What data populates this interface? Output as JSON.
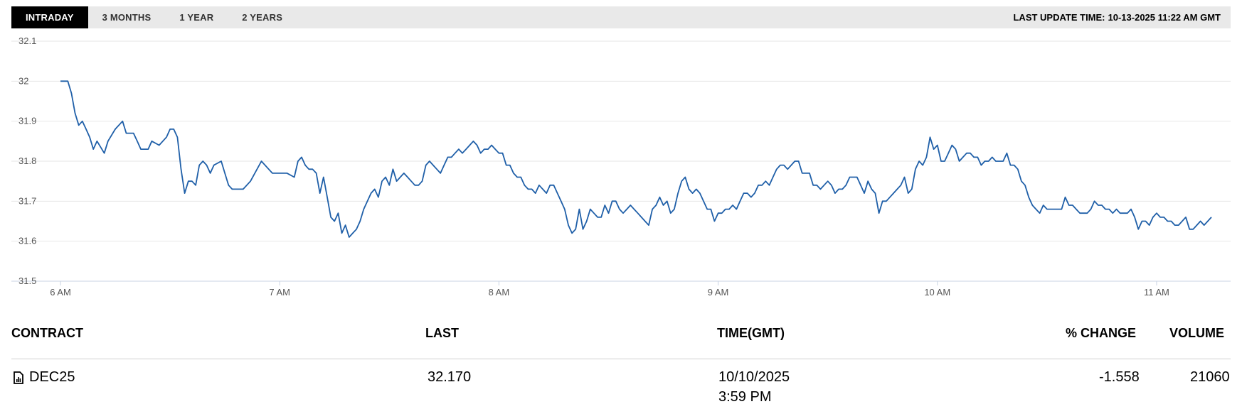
{
  "tabs": [
    {
      "label": "INTRADAY",
      "active": true
    },
    {
      "label": "3 MONTHS",
      "active": false
    },
    {
      "label": "1 YEAR",
      "active": false
    },
    {
      "label": "2 YEARS",
      "active": false
    }
  ],
  "last_update": {
    "label": "LAST UPDATE TIME:",
    "value": "10-13-2025 11:22 AM GMT"
  },
  "chart_data": {
    "type": "line",
    "title": "",
    "xlabel": "",
    "ylabel": "",
    "y_ticks": [
      "32.1",
      "32",
      "31.9",
      "31.8",
      "31.7",
      "31.6",
      "31.5"
    ],
    "ylim": [
      31.5,
      32.1
    ],
    "x_ticks": [
      "6 AM",
      "7 AM",
      "8 AM",
      "9 AM",
      "10 AM",
      "11 AM"
    ],
    "x_tick_minutes": [
      360,
      420,
      480,
      540,
      600,
      660
    ],
    "xlim_minutes": [
      360,
      675
    ],
    "grid": true,
    "line_color": "#1f5fa8",
    "series": [
      {
        "x_minutes": [
          360,
          362,
          363,
          364,
          365,
          366,
          367,
          368,
          369,
          370,
          372,
          373,
          375,
          377,
          378,
          380,
          381,
          382,
          384,
          385,
          387,
          389,
          390,
          391,
          392,
          393,
          394,
          395,
          396,
          397,
          398,
          399,
          400,
          401,
          402,
          404,
          405,
          406,
          407,
          408,
          409,
          410,
          412,
          415,
          418,
          420,
          422,
          424,
          425,
          426,
          427,
          428,
          429,
          430,
          431,
          432,
          433,
          434,
          435,
          436,
          437,
          438,
          439,
          440,
          441,
          442,
          443,
          444,
          445,
          446,
          447,
          448,
          449,
          450,
          451,
          452,
          453,
          454,
          455,
          456,
          457,
          458,
          459,
          460,
          461,
          462,
          463,
          464,
          465,
          466,
          467,
          468,
          469,
          470,
          471,
          472,
          473,
          474,
          475,
          476,
          477,
          478,
          479,
          480,
          481,
          482,
          483,
          484,
          485,
          486,
          487,
          488,
          489,
          490,
          491,
          492,
          493,
          494,
          495,
          496,
          497,
          498,
          499,
          500,
          501,
          502,
          503,
          504,
          505,
          506,
          507,
          508,
          509,
          510,
          511,
          512,
          513,
          514,
          515,
          516,
          517,
          518,
          519,
          520,
          521,
          522,
          523,
          524,
          525,
          526,
          527,
          528,
          529,
          530,
          531,
          532,
          533,
          534,
          535,
          536,
          537,
          538,
          539,
          540,
          541,
          542,
          543,
          544,
          545,
          546,
          547,
          548,
          549,
          550,
          551,
          552,
          553,
          554,
          555,
          556,
          557,
          558,
          559,
          560,
          561,
          562,
          563,
          564,
          565,
          566,
          567,
          568,
          569,
          570,
          571,
          572,
          573,
          574,
          575,
          576,
          577,
          578,
          579,
          580,
          581,
          582,
          583,
          584,
          585,
          586,
          587,
          588,
          589,
          590,
          591,
          592,
          593,
          594,
          595,
          596,
          597,
          598,
          599,
          600,
          601,
          602,
          603,
          604,
          605,
          606,
          607,
          608,
          609,
          610,
          611,
          612,
          613,
          614,
          615,
          616,
          617,
          618,
          619,
          620,
          621,
          622,
          623,
          624,
          625,
          626,
          627,
          628,
          629,
          630,
          631,
          632,
          633,
          634,
          635,
          636,
          637,
          638,
          639,
          640,
          641,
          642,
          643,
          644,
          645,
          646,
          647,
          648,
          649,
          650,
          651,
          652,
          653,
          654,
          655,
          656,
          657,
          658,
          659,
          660,
          661,
          662,
          663,
          664,
          665,
          666,
          667,
          668,
          669,
          670,
          671,
          672,
          673,
          674,
          675
        ],
        "values": [
          32.0,
          32.0,
          31.97,
          31.92,
          31.89,
          31.9,
          31.88,
          31.86,
          31.83,
          31.85,
          31.82,
          31.85,
          31.88,
          31.9,
          31.87,
          31.87,
          31.85,
          31.83,
          31.83,
          31.85,
          31.84,
          31.86,
          31.88,
          31.88,
          31.86,
          31.78,
          31.72,
          31.75,
          31.75,
          31.74,
          31.79,
          31.8,
          31.79,
          31.77,
          31.79,
          31.8,
          31.77,
          31.74,
          31.73,
          31.73,
          31.73,
          31.73,
          31.75,
          31.8,
          31.77,
          31.77,
          31.77,
          31.76,
          31.8,
          31.81,
          31.79,
          31.78,
          31.78,
          31.77,
          31.72,
          31.76,
          31.71,
          31.66,
          31.65,
          31.67,
          31.62,
          31.64,
          31.61,
          31.62,
          31.63,
          31.65,
          31.68,
          31.7,
          31.72,
          31.73,
          31.71,
          31.75,
          31.76,
          31.74,
          31.78,
          31.75,
          31.76,
          31.77,
          31.76,
          31.75,
          31.74,
          31.74,
          31.75,
          31.79,
          31.8,
          31.79,
          31.78,
          31.77,
          31.79,
          31.81,
          31.81,
          31.82,
          31.83,
          31.82,
          31.83,
          31.84,
          31.85,
          31.84,
          31.82,
          31.83,
          31.83,
          31.84,
          31.83,
          31.82,
          31.82,
          31.79,
          31.79,
          31.77,
          31.76,
          31.76,
          31.74,
          31.73,
          31.73,
          31.72,
          31.74,
          31.73,
          31.72,
          31.74,
          31.74,
          31.72,
          31.7,
          31.68,
          31.64,
          31.62,
          31.63,
          31.68,
          31.63,
          31.65,
          31.68,
          31.67,
          31.66,
          31.66,
          31.69,
          31.67,
          31.7,
          31.7,
          31.68,
          31.67,
          31.68,
          31.69,
          31.68,
          31.67,
          31.66,
          31.65,
          31.64,
          31.68,
          31.69,
          31.71,
          31.69,
          31.7,
          31.67,
          31.68,
          31.72,
          31.75,
          31.76,
          31.73,
          31.72,
          31.73,
          31.72,
          31.7,
          31.68,
          31.68,
          31.65,
          31.67,
          31.67,
          31.68,
          31.68,
          31.69,
          31.68,
          31.7,
          31.72,
          31.72,
          31.71,
          31.72,
          31.74,
          31.74,
          31.75,
          31.74,
          31.76,
          31.78,
          31.79,
          31.79,
          31.78,
          31.79,
          31.8,
          31.8,
          31.77,
          31.77,
          31.77,
          31.74,
          31.74,
          31.73,
          31.74,
          31.75,
          31.74,
          31.72,
          31.73,
          31.73,
          31.74,
          31.76,
          31.76,
          31.76,
          31.74,
          31.72,
          31.75,
          31.73,
          31.72,
          31.67,
          31.7,
          31.7,
          31.71,
          31.72,
          31.73,
          31.74,
          31.76,
          31.72,
          31.73,
          31.78,
          31.8,
          31.79,
          31.81,
          31.86,
          31.83,
          31.84,
          31.8,
          31.8,
          31.82,
          31.84,
          31.83,
          31.8,
          31.81,
          31.82,
          31.82,
          31.81,
          31.81,
          31.79,
          31.8,
          31.8,
          31.81,
          31.8,
          31.8,
          31.8,
          31.82,
          31.79,
          31.79,
          31.78,
          31.75,
          31.74,
          31.71,
          31.69,
          31.68,
          31.67,
          31.69,
          31.68,
          31.68,
          31.68,
          31.68,
          31.68,
          31.71,
          31.69,
          31.69,
          31.68,
          31.67,
          31.67,
          31.67,
          31.68,
          31.7,
          31.69,
          31.69,
          31.68,
          31.68,
          31.67,
          31.68,
          31.67,
          31.67,
          31.67,
          31.68,
          31.66,
          31.63,
          31.65,
          31.65,
          31.64,
          31.66,
          31.67,
          31.66,
          31.66,
          31.65,
          31.65,
          31.64,
          31.64,
          31.65,
          31.66,
          31.63,
          31.63,
          31.64,
          31.65,
          31.64,
          31.65,
          31.66,
          31.64,
          31.66,
          31.66,
          31.67,
          31.67,
          31.68,
          31.68,
          31.69,
          31.66,
          31.66,
          31.63,
          31.62,
          31.62,
          31.62,
          31.61,
          31.61
        ]
      }
    ]
  },
  "table": {
    "headers": {
      "contract": "CONTRACT",
      "last": "LAST",
      "time": "TIME(GMT)",
      "change": "% CHANGE",
      "volume": "VOLUME"
    },
    "row": {
      "contract": "DEC25",
      "icon": "document-chart-icon",
      "last": "32.170",
      "date": "10/10/2025",
      "time": "3:59 PM",
      "change": "-1.558",
      "volume": "21060"
    }
  }
}
